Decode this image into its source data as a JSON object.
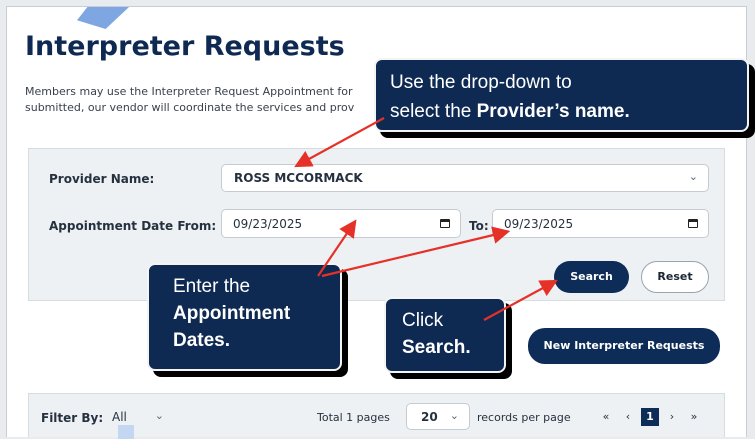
{
  "page": {
    "title": "Interpreter Requests",
    "intro_line1": "Members may use the Interpreter Request Appointment for",
    "intro_line2": "submitted, our vendor will coordinate the services and prov"
  },
  "form": {
    "provider_label": "Provider Name:",
    "provider_value": "ROSS MCCORMACK",
    "date_from_label": "Appointment Date From:",
    "date_from_value": "09/23/2025",
    "to_label": "To:",
    "date_to_value": "09/23/2025",
    "search_label": "Search",
    "reset_label": "Reset"
  },
  "actions": {
    "new_request_label": "New Interpreter Requests"
  },
  "filter": {
    "label": "Filter By:",
    "value": "All",
    "total_pages": "Total 1 pages",
    "page_size": "20",
    "records_per_page": "records per page",
    "first": "«",
    "prev": "‹",
    "current": "1",
    "next": "›",
    "last": "»"
  },
  "callouts": {
    "provider_line1": "Use the drop-down to",
    "provider_line2_plain": "select the ",
    "provider_line2_bold": "Provider’s name.",
    "dates_line1": "Enter the",
    "dates_line2": "Appointment",
    "dates_line3": "Dates.",
    "search_line1": "Click",
    "search_line2": "Search."
  },
  "colors": {
    "navy": "#0e2a53",
    "arrow": "#e53127",
    "panel": "#eef1f4"
  },
  "icons": {
    "dropdown": "chevron-down-icon",
    "calendar": "calendar-icon"
  }
}
